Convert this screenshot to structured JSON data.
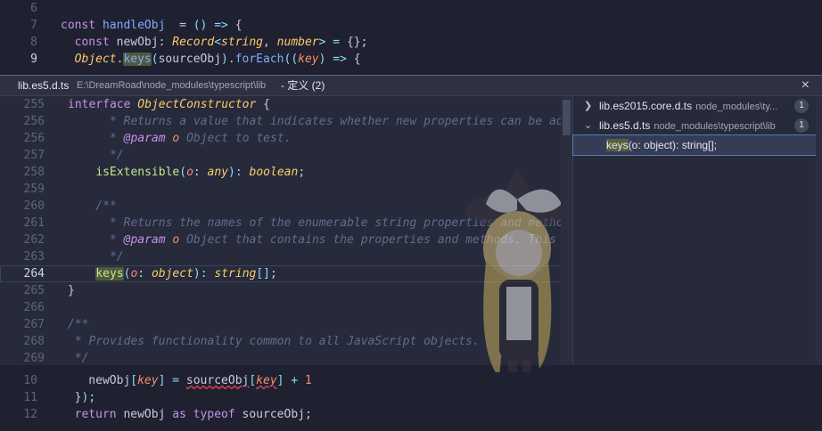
{
  "editor_top": [
    {
      "num": "6",
      "tokens": []
    },
    {
      "num": "7",
      "tokens": [
        [
          "kw",
          "const "
        ],
        [
          "fn",
          "handleObj"
        ],
        [
          "",
          "  = "
        ],
        [
          "op",
          "()"
        ],
        [
          "op",
          " => "
        ],
        [
          "",
          "{"
        ]
      ]
    },
    {
      "num": "8",
      "tokens": [
        [
          "",
          "  "
        ],
        [
          "kw",
          "const "
        ],
        [
          "",
          "newObj"
        ],
        [
          "",
          ": "
        ],
        [
          "ty",
          "Record"
        ],
        [
          "op",
          "<"
        ],
        [
          "ty",
          "string"
        ],
        [
          "",
          ", "
        ],
        [
          "ty",
          "number"
        ],
        [
          "op",
          "> "
        ],
        [
          "",
          ""
        ],
        [
          "op",
          "= "
        ],
        [
          "",
          "{};"
        ]
      ]
    },
    {
      "num": "9",
      "tokens": [
        [
          "",
          "  "
        ],
        [
          "ty",
          "Object"
        ],
        [
          "",
          "."
        ],
        [
          "hl fn",
          "keys"
        ],
        [
          "",
          ""
        ],
        [
          "op",
          "("
        ],
        [
          "",
          "sourceObj"
        ],
        [
          "op",
          ")"
        ],
        [
          "",
          "."
        ],
        [
          "fn",
          "forEach"
        ],
        [
          "op",
          "(("
        ],
        [
          "prm",
          "key"
        ],
        [
          "op",
          ") => "
        ],
        [
          "",
          "{"
        ]
      ]
    }
  ],
  "peek": {
    "file": "lib.es5.d.ts",
    "path": "E:\\DreamRoad\\node_modules\\typescript\\lib",
    "title": "- 定义 (2)",
    "close_icon": "×"
  },
  "peek_code": [
    {
      "num": "255",
      "tokens": [
        [
          "kw",
          "interface "
        ],
        [
          "ty",
          "ObjectConstructor "
        ],
        [
          "",
          "{"
        ]
      ]
    },
    {
      "num": "256",
      "tokens": [
        [
          "cmt",
          "      * Returns a value that indicates whether new properties can be added"
        ]
      ]
    },
    {
      "num": "256",
      "tokens": [
        [
          "cmt",
          "      * "
        ],
        [
          "cmt-tag",
          "@param "
        ],
        [
          "prm",
          "o "
        ],
        [
          "cmt",
          "Object to test."
        ]
      ]
    },
    {
      "num": "257",
      "tokens": [
        [
          "cmt",
          "      */"
        ]
      ]
    },
    {
      "num": "258",
      "tokens": [
        [
          "",
          "    "
        ],
        [
          "prop",
          "isExtensible"
        ],
        [
          "op",
          "("
        ],
        [
          "prm",
          "o"
        ],
        [
          "",
          ": "
        ],
        [
          "ty",
          "any"
        ],
        [
          "op",
          "): "
        ],
        [
          "ty",
          "boolean"
        ],
        [
          "",
          ";"
        ]
      ]
    },
    {
      "num": "259",
      "tokens": []
    },
    {
      "num": "260",
      "tokens": [
        [
          "cmt",
          "    /**"
        ]
      ]
    },
    {
      "num": "261",
      "tokens": [
        [
          "cmt",
          "      * Returns the names of the enumerable string properties and methods o"
        ]
      ]
    },
    {
      "num": "262",
      "tokens": [
        [
          "cmt",
          "      * "
        ],
        [
          "cmt-tag",
          "@param "
        ],
        [
          "prm",
          "o "
        ],
        [
          "cmt",
          "Object that contains the properties and methods. This can"
        ]
      ]
    },
    {
      "num": "263",
      "tokens": [
        [
          "cmt",
          "      */"
        ]
      ]
    },
    {
      "num": "264",
      "active": true,
      "tokens": [
        [
          "",
          "    "
        ],
        [
          "hl prop",
          "keys"
        ],
        [
          "op",
          "("
        ],
        [
          "prm",
          "o"
        ],
        [
          "",
          ": "
        ],
        [
          "ty",
          "object"
        ],
        [
          "op",
          "): "
        ],
        [
          "ty",
          "string"
        ],
        [
          "op",
          "[]"
        ],
        [
          "",
          ";"
        ]
      ]
    },
    {
      "num": "265",
      "tokens": [
        [
          "",
          "}"
        ]
      ]
    },
    {
      "num": "266",
      "tokens": []
    },
    {
      "num": "267",
      "tokens": [
        [
          "cmt",
          "/**"
        ]
      ]
    },
    {
      "num": "268",
      "tokens": [
        [
          "cmt",
          " * Provides functionality common to all JavaScript objects."
        ]
      ]
    },
    {
      "num": "269",
      "tokens": [
        [
          "cmt",
          " */"
        ]
      ]
    }
  ],
  "references": {
    "groups": [
      {
        "name": "lib.es2015.core.d.ts",
        "path": "node_modules\\ty...",
        "count": "1",
        "expanded": false
      },
      {
        "name": "lib.es5.d.ts",
        "path": "node_modules\\typescript\\lib",
        "count": "1",
        "expanded": true
      }
    ],
    "item": {
      "highlight": "keys",
      "rest": "(o: object): string[];"
    }
  },
  "editor_bottom": [
    {
      "num": "10",
      "tokens": [
        [
          "",
          "    newObj"
        ],
        [
          "op",
          "["
        ],
        [
          "prm",
          "key"
        ],
        [
          "op",
          "] "
        ],
        [
          "op",
          "= "
        ],
        [
          "squig",
          "sourceObj"
        ],
        [
          "op",
          "["
        ],
        [
          "prm squig",
          "key"
        ],
        [
          "op",
          "] "
        ],
        [
          "op",
          "+ "
        ],
        [
          "num",
          "1"
        ]
      ]
    },
    {
      "num": "11",
      "tokens": [
        [
          "",
          "  }"
        ],
        [
          "op",
          ")"
        ],
        [
          "",
          ";"
        ]
      ]
    },
    {
      "num": "12",
      "tokens": [
        [
          "",
          "  "
        ],
        [
          "kw",
          "return "
        ],
        [
          "",
          "newObj "
        ],
        [
          "kw",
          "as typeof "
        ],
        [
          "",
          "sourceObj;"
        ]
      ]
    }
  ]
}
